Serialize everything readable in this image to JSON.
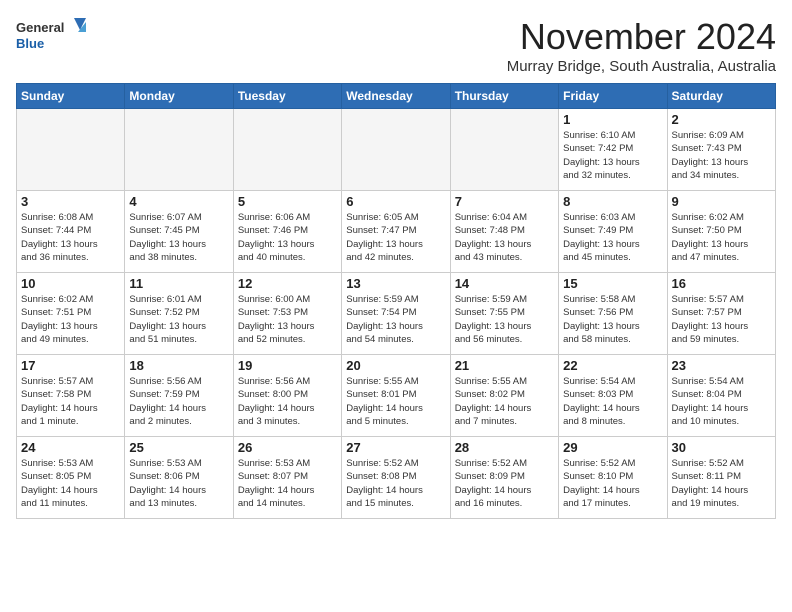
{
  "header": {
    "logo_general": "General",
    "logo_blue": "Blue",
    "month_title": "November 2024",
    "location": "Murray Bridge, South Australia, Australia"
  },
  "days_of_week": [
    "Sunday",
    "Monday",
    "Tuesday",
    "Wednesday",
    "Thursday",
    "Friday",
    "Saturday"
  ],
  "weeks": [
    [
      {
        "day": "",
        "info": ""
      },
      {
        "day": "",
        "info": ""
      },
      {
        "day": "",
        "info": ""
      },
      {
        "day": "",
        "info": ""
      },
      {
        "day": "",
        "info": ""
      },
      {
        "day": "1",
        "info": "Sunrise: 6:10 AM\nSunset: 7:42 PM\nDaylight: 13 hours\nand 32 minutes."
      },
      {
        "day": "2",
        "info": "Sunrise: 6:09 AM\nSunset: 7:43 PM\nDaylight: 13 hours\nand 34 minutes."
      }
    ],
    [
      {
        "day": "3",
        "info": "Sunrise: 6:08 AM\nSunset: 7:44 PM\nDaylight: 13 hours\nand 36 minutes."
      },
      {
        "day": "4",
        "info": "Sunrise: 6:07 AM\nSunset: 7:45 PM\nDaylight: 13 hours\nand 38 minutes."
      },
      {
        "day": "5",
        "info": "Sunrise: 6:06 AM\nSunset: 7:46 PM\nDaylight: 13 hours\nand 40 minutes."
      },
      {
        "day": "6",
        "info": "Sunrise: 6:05 AM\nSunset: 7:47 PM\nDaylight: 13 hours\nand 42 minutes."
      },
      {
        "day": "7",
        "info": "Sunrise: 6:04 AM\nSunset: 7:48 PM\nDaylight: 13 hours\nand 43 minutes."
      },
      {
        "day": "8",
        "info": "Sunrise: 6:03 AM\nSunset: 7:49 PM\nDaylight: 13 hours\nand 45 minutes."
      },
      {
        "day": "9",
        "info": "Sunrise: 6:02 AM\nSunset: 7:50 PM\nDaylight: 13 hours\nand 47 minutes."
      }
    ],
    [
      {
        "day": "10",
        "info": "Sunrise: 6:02 AM\nSunset: 7:51 PM\nDaylight: 13 hours\nand 49 minutes."
      },
      {
        "day": "11",
        "info": "Sunrise: 6:01 AM\nSunset: 7:52 PM\nDaylight: 13 hours\nand 51 minutes."
      },
      {
        "day": "12",
        "info": "Sunrise: 6:00 AM\nSunset: 7:53 PM\nDaylight: 13 hours\nand 52 minutes."
      },
      {
        "day": "13",
        "info": "Sunrise: 5:59 AM\nSunset: 7:54 PM\nDaylight: 13 hours\nand 54 minutes."
      },
      {
        "day": "14",
        "info": "Sunrise: 5:59 AM\nSunset: 7:55 PM\nDaylight: 13 hours\nand 56 minutes."
      },
      {
        "day": "15",
        "info": "Sunrise: 5:58 AM\nSunset: 7:56 PM\nDaylight: 13 hours\nand 58 minutes."
      },
      {
        "day": "16",
        "info": "Sunrise: 5:57 AM\nSunset: 7:57 PM\nDaylight: 13 hours\nand 59 minutes."
      }
    ],
    [
      {
        "day": "17",
        "info": "Sunrise: 5:57 AM\nSunset: 7:58 PM\nDaylight: 14 hours\nand 1 minute."
      },
      {
        "day": "18",
        "info": "Sunrise: 5:56 AM\nSunset: 7:59 PM\nDaylight: 14 hours\nand 2 minutes."
      },
      {
        "day": "19",
        "info": "Sunrise: 5:56 AM\nSunset: 8:00 PM\nDaylight: 14 hours\nand 3 minutes."
      },
      {
        "day": "20",
        "info": "Sunrise: 5:55 AM\nSunset: 8:01 PM\nDaylight: 14 hours\nand 5 minutes."
      },
      {
        "day": "21",
        "info": "Sunrise: 5:55 AM\nSunset: 8:02 PM\nDaylight: 14 hours\nand 7 minutes."
      },
      {
        "day": "22",
        "info": "Sunrise: 5:54 AM\nSunset: 8:03 PM\nDaylight: 14 hours\nand 8 minutes."
      },
      {
        "day": "23",
        "info": "Sunrise: 5:54 AM\nSunset: 8:04 PM\nDaylight: 14 hours\nand 10 minutes."
      }
    ],
    [
      {
        "day": "24",
        "info": "Sunrise: 5:53 AM\nSunset: 8:05 PM\nDaylight: 14 hours\nand 11 minutes."
      },
      {
        "day": "25",
        "info": "Sunrise: 5:53 AM\nSunset: 8:06 PM\nDaylight: 14 hours\nand 13 minutes."
      },
      {
        "day": "26",
        "info": "Sunrise: 5:53 AM\nSunset: 8:07 PM\nDaylight: 14 hours\nand 14 minutes."
      },
      {
        "day": "27",
        "info": "Sunrise: 5:52 AM\nSunset: 8:08 PM\nDaylight: 14 hours\nand 15 minutes."
      },
      {
        "day": "28",
        "info": "Sunrise: 5:52 AM\nSunset: 8:09 PM\nDaylight: 14 hours\nand 16 minutes."
      },
      {
        "day": "29",
        "info": "Sunrise: 5:52 AM\nSunset: 8:10 PM\nDaylight: 14 hours\nand 17 minutes."
      },
      {
        "day": "30",
        "info": "Sunrise: 5:52 AM\nSunset: 8:11 PM\nDaylight: 14 hours\nand 19 minutes."
      }
    ]
  ]
}
